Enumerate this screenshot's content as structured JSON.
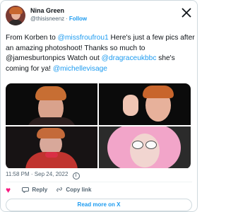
{
  "author": {
    "name": "Nina Green",
    "handle": "@thisisneenz",
    "follow": "Follow"
  },
  "tweet": {
    "text_before": "From Korben to ",
    "mention_1": "@missfroufrou1",
    "text_mid_1": " Here's just a few pics after an amazing photoshoot! Thanks so much to @jamesburtonpics Watch out ",
    "mention_2": "@dragraceukbbc",
    "text_mid_2": " she's coming for ya! ",
    "mention_3": "@michellevisage"
  },
  "meta": {
    "time": "11:58 PM",
    "separator": "·",
    "date": "Sep 24, 2022",
    "info": "i"
  },
  "actions": {
    "like_icon": "heart-icon",
    "reply_icon": "reply-icon",
    "copy_icon": "link-icon",
    "reply": "Reply",
    "copy": "Copy link"
  },
  "footer": {
    "read_more": "Read more on X"
  },
  "colors": {
    "accent": "#1d9bf0",
    "heart": "#f91880",
    "text": "#0f1419",
    "muted": "#536471"
  }
}
